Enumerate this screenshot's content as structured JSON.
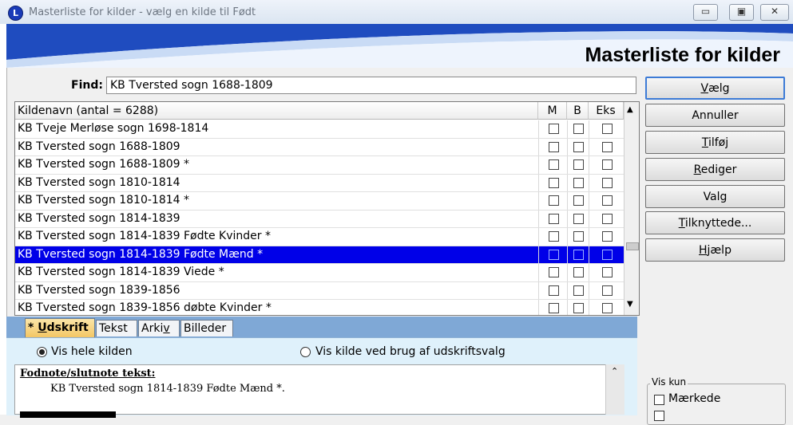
{
  "window": {
    "title": "Masterliste for kilder - vælg en kilde til Født",
    "minimize": "▭",
    "maximize": "▣",
    "close": "✕",
    "app_icon_letter": "L"
  },
  "banner": {
    "title": "Masterliste for kilder"
  },
  "find": {
    "label": "Find:",
    "value": "KB Tversted sogn 1688-1809"
  },
  "list": {
    "header": {
      "name": "Kildenavn (antal = 6288)",
      "m": "M",
      "b": "B",
      "eks": "Eks"
    },
    "rows": [
      "KB Tveje Merløse sogn 1698-1814",
      "KB Tversted sogn 1688-1809",
      "KB Tversted sogn 1688-1809 *",
      "KB Tversted sogn 1810-1814",
      "KB Tversted sogn 1810-1814 *",
      "KB Tversted sogn 1814-1839",
      "KB Tversted sogn 1814-1839 Fødte Kvinder *",
      "KB Tversted sogn 1814-1839 Fødte Mænd *",
      "KB Tversted sogn 1814-1839 Viede *",
      "KB Tversted sogn 1839-1856",
      "KB Tversted sogn 1839-1856 døbte Kvinder *"
    ],
    "selected_index": 7,
    "scroll_up": "▲",
    "scroll_down": "▼"
  },
  "buttons": {
    "vaelg": {
      "u": "V",
      "rest": "ælg"
    },
    "annuller": "Annuller",
    "tilfoej": {
      "u": "T",
      "rest": "ilføj"
    },
    "rediger": {
      "u": "R",
      "rest": "ediger"
    },
    "valg": "Valg",
    "tilknyttede": {
      "u": "T",
      "rest": "ilknyttede..."
    },
    "hjaelp": {
      "u": "H",
      "rest": "jælp"
    }
  },
  "tabs": {
    "udskrift": {
      "prefix": "* ",
      "u": "U",
      "rest": "dskrift"
    },
    "tekst": "Tekst",
    "arkiv": {
      "pre": "Arki",
      "u": "v"
    },
    "billeder": "Billeder"
  },
  "panel": {
    "radio_all": "Vis hele kilden",
    "radio_print": "Vis kilde ved brug af udskriftsvalg",
    "footnote_label": "Fodnote/slutnote tekst:",
    "footnote_text": "KB Tversted sogn 1814-1839 Fødte Mænd *."
  },
  "vis_kun": {
    "label": "Vis kun",
    "option1": "Mærkede"
  }
}
